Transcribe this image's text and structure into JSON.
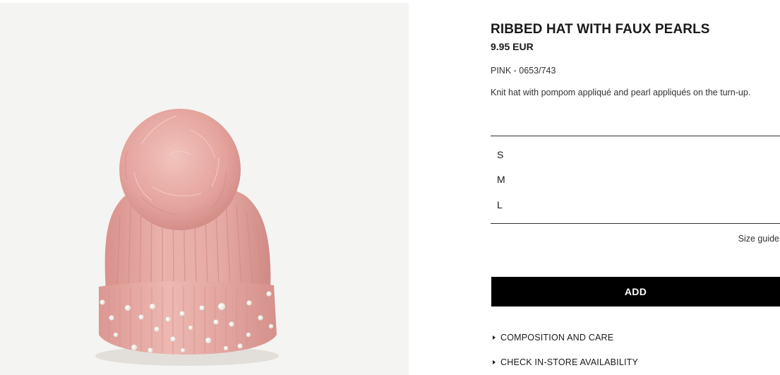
{
  "product": {
    "title": "RIBBED HAT WITH FAUX PEARLS",
    "price": "9.95 EUR",
    "color_ref": "PINK - 0653/743",
    "description": "Knit hat with pompom appliqué and pearl appliqués on the turn-up.",
    "image_alt": "Pink ribbed hat with pompom and faux pearls"
  },
  "sizes": [
    {
      "label": "S"
    },
    {
      "label": "M"
    },
    {
      "label": "L"
    }
  ],
  "size_guide_label": "Size guide",
  "add_button_label": "ADD",
  "accordions": [
    {
      "label": "COMPOSITION AND CARE",
      "icon": "caret-right-icon"
    },
    {
      "label": "CHECK IN-STORE AVAILABILITY",
      "icon": "caret-right-icon"
    }
  ],
  "colors": {
    "button_bg": "#000000",
    "hat_pink": "#e8aba6",
    "background": "#f4f4f2"
  }
}
